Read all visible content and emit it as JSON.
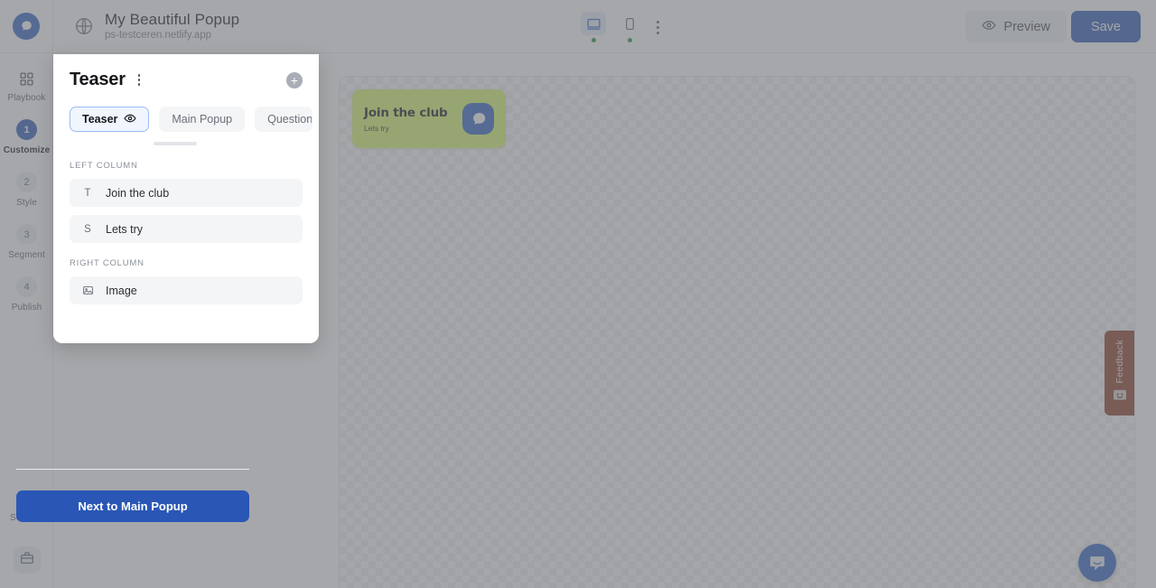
{
  "topbar": {
    "logo_icon": "chat-bubble-logo",
    "globe_icon": "globe-icon",
    "project_title": "My Beautiful Popup",
    "project_url": "ps-testceren.netlify.app",
    "devices": [
      {
        "name": "desktop",
        "icon": "desktop-icon",
        "active": true,
        "status": "online"
      },
      {
        "name": "mobile",
        "icon": "mobile-icon",
        "active": false,
        "status": "online"
      }
    ],
    "more_icon": "kebab-menu-icon",
    "preview_label": "Preview",
    "preview_icon": "eye-icon",
    "save_label": "Save"
  },
  "sidebar": {
    "playbook": {
      "label": "Playbook",
      "icon": "grid-icon"
    },
    "steps": [
      {
        "num": "1",
        "label": "Customize",
        "active": true
      },
      {
        "num": "2",
        "label": "Style",
        "active": false
      },
      {
        "num": "3",
        "label": "Segment",
        "active": false
      },
      {
        "num": "4",
        "label": "Publish",
        "active": false
      }
    ],
    "settings": {
      "label": "Settings",
      "icon": "gear-icon"
    },
    "avatar_icon": "briefcase-icon"
  },
  "panel": {
    "title": "Teaser",
    "kebab_icon": "kebab-menu-icon",
    "add_icon": "plus-circle-icon",
    "tabs": [
      {
        "label": "Teaser",
        "active": true,
        "icon": "eye-icon"
      },
      {
        "label": "Main Popup",
        "active": false
      },
      {
        "label": "Question P",
        "active": false
      }
    ],
    "left_column_label": "LEFT COLUMN",
    "left_column_fields": [
      {
        "icon": "text-title-icon",
        "glyph": "T",
        "label": "Join the club"
      },
      {
        "icon": "text-subtitle-icon",
        "glyph": "S",
        "label": "Lets try"
      }
    ],
    "right_column_label": "RIGHT COLUMN",
    "right_column_fields": [
      {
        "icon": "image-icon",
        "glyph": "",
        "label": "Image"
      }
    ],
    "next_button_label": "Next to Main Popup"
  },
  "canvas": {
    "teaser_preview": {
      "title": "Join the club",
      "subtitle": "Lets try",
      "badge_icon": "chat-bubble-icon",
      "background_color": "#dbfa6c",
      "badge_color": "#2f62c4"
    },
    "feedback_tab": {
      "label": "Feedback",
      "icon": "smiley-face-icon",
      "color": "#8c3a22"
    },
    "chat_launcher": {
      "icon": "chat-bubble-icon",
      "color": "#2f62c4"
    }
  }
}
